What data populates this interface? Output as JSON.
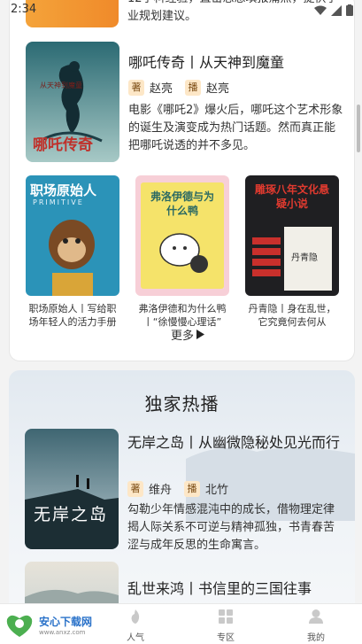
{
  "status": {
    "time": "2:34"
  },
  "top_card": {
    "partial_desc": "12学科经验，直击思想填报痛点，提供学业规划建议。",
    "feature": {
      "title": "哪吒传奇丨从天神到魔童",
      "cover_text": "哪吒传奇",
      "cover_top_text": "从天神到魔童",
      "author_tag": "著",
      "author": "赵亮",
      "narrator_tag": "播",
      "narrator": "赵亮",
      "desc": "电影《哪吒2》爆火后，哪吒这个艺术形象的诞生及演变成为热门话题。然而真正能把哪吒说透的并不多见。"
    },
    "books": [
      {
        "cover_text": "职场原始人",
        "cover_sub": "PRIMITIVE",
        "title": "职场原始人丨写给职场年轻人的活力手册"
      },
      {
        "cover_text": "弗洛伊德与为什么鸭",
        "title": "弗洛伊德和为什么鸭丨“徐慢慢心理话”"
      },
      {
        "cover_text": "雕琢八年文化悬疑小说",
        "cover_sub": "丹青隐",
        "title": "丹青隐丨身在乱世，它究竟何去何从"
      }
    ],
    "more_label": "更多"
  },
  "exclusive": {
    "section_title": "独家热播",
    "item1": {
      "title": "无岸之岛丨从幽微隐秘处见光而行",
      "cover_text": "无岸之岛",
      "author_tag": "著",
      "author": "维舟",
      "narrator_tag": "播",
      "narrator": "北竹",
      "desc": "勾勒少年情感混沌中的成长，借物理定律揭人际关系不可逆与精神孤独，书青春苦涩与成年反思的生命寓言。"
    },
    "item2": {
      "title": "乱世来鸿丨书信里的三国往事"
    }
  },
  "nav": {
    "items": [
      {
        "label": "人气",
        "icon": "flame-icon"
      },
      {
        "label": "专区",
        "icon": "grid-icon"
      },
      {
        "label": "我的",
        "icon": "person-icon"
      }
    ]
  },
  "watermark": {
    "main": "安心下载网",
    "sub": "www.anxz.com"
  }
}
